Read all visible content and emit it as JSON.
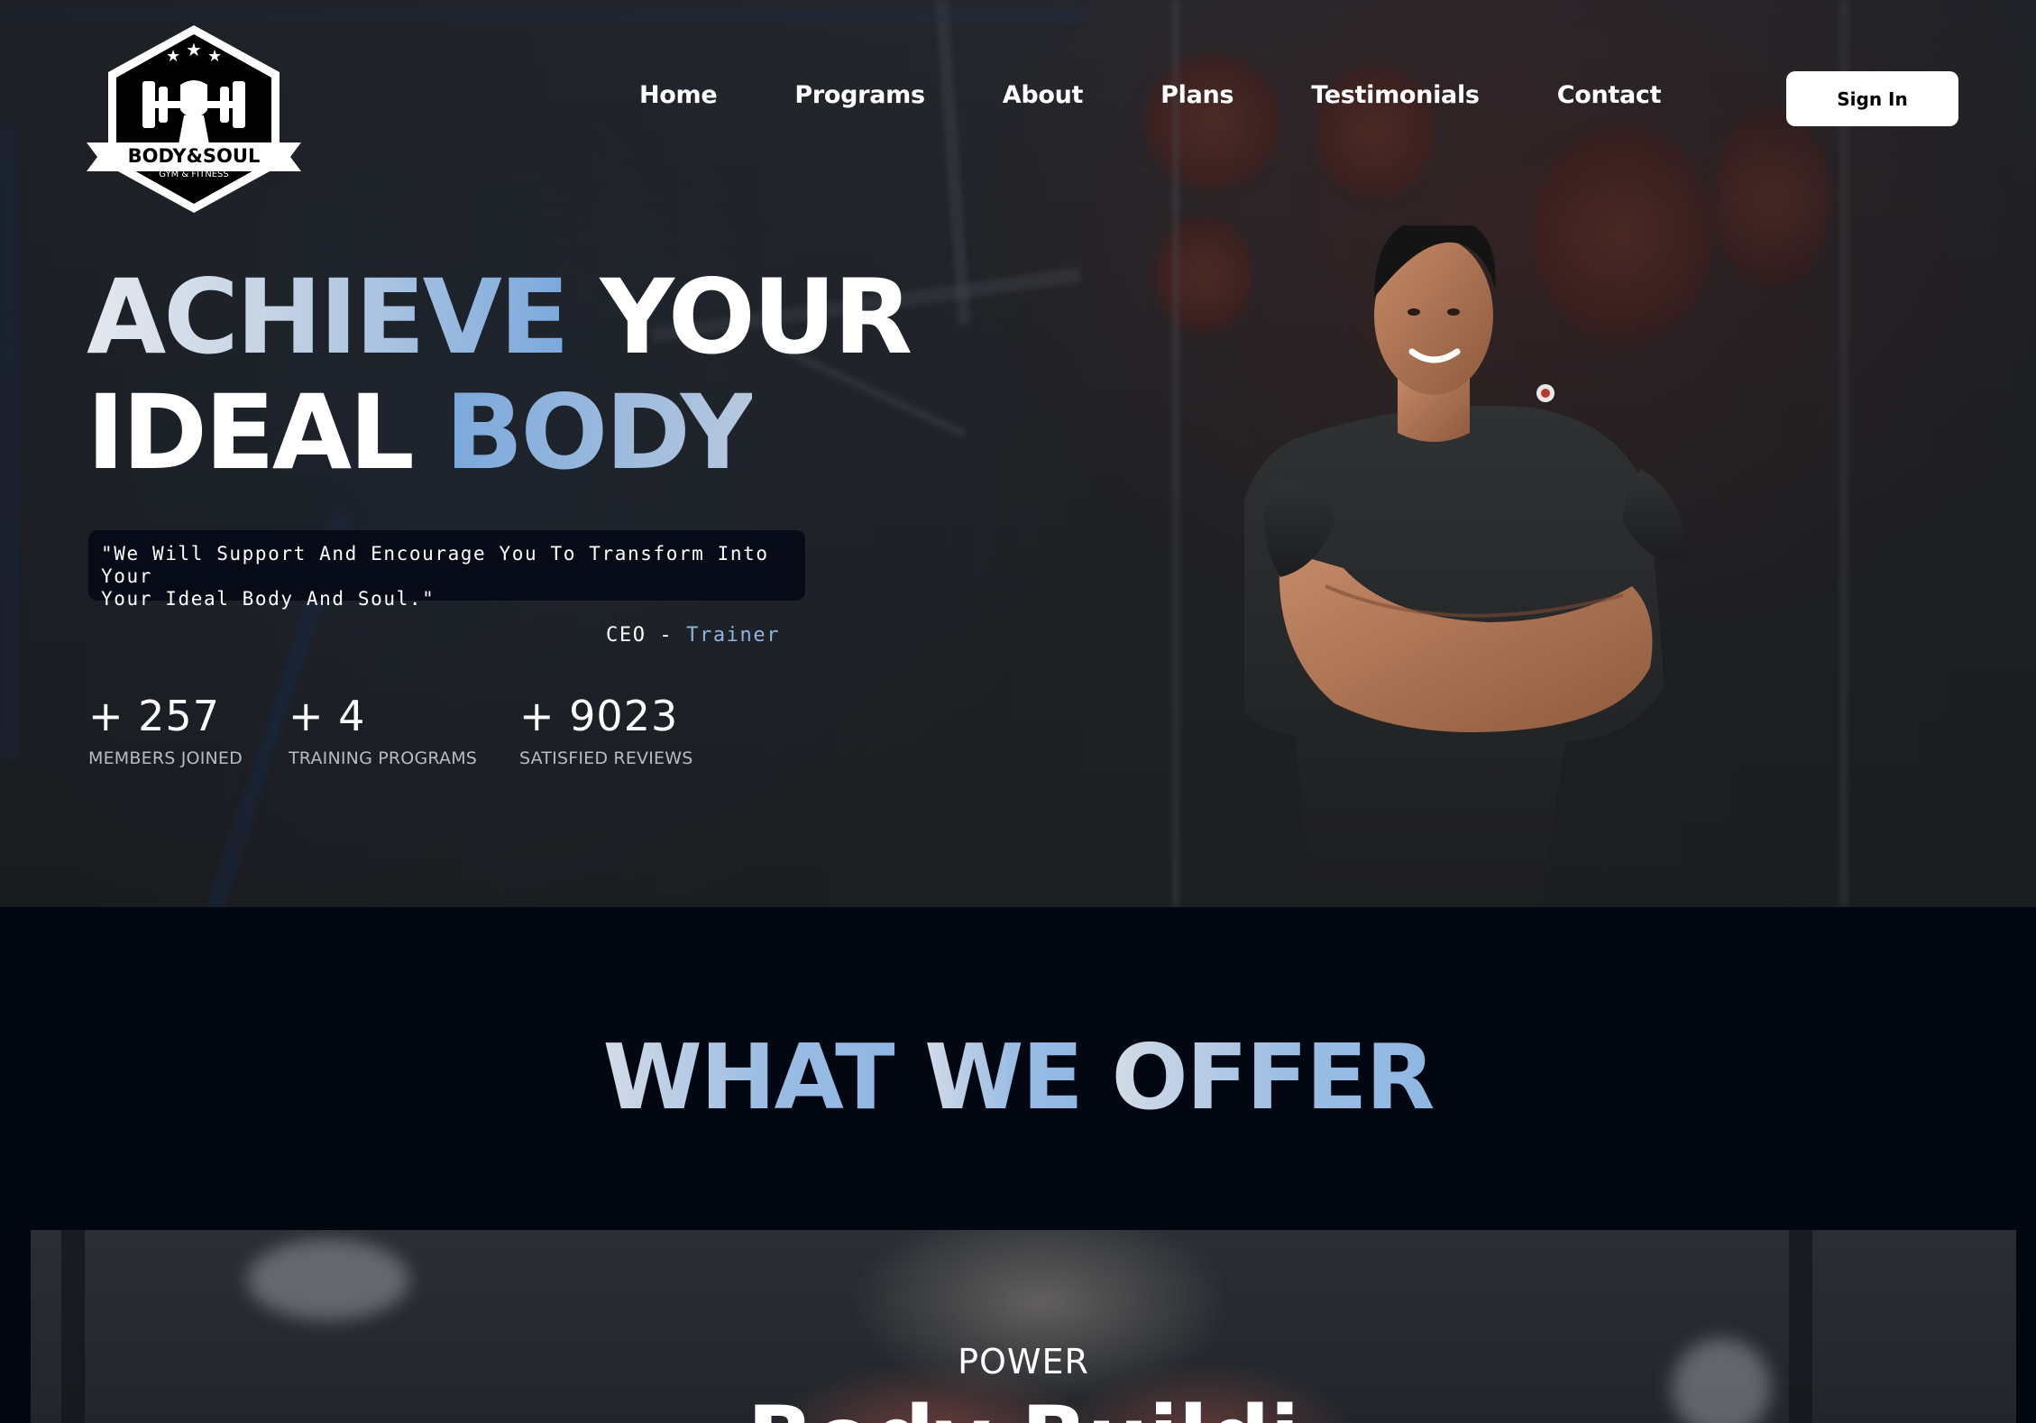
{
  "brand": {
    "name": "BODY&SOUL",
    "tagline": "GYM & FITNESS"
  },
  "nav": {
    "items": [
      "Home",
      "Programs",
      "About",
      "Plans",
      "Testimonials",
      "Contact"
    ],
    "signin_label": "Sign In"
  },
  "hero": {
    "headline": {
      "line1_a": "ACHIEVE",
      "line1_b": "YOUR",
      "line2_a": "IDEAL",
      "line2_b": "BODY"
    },
    "quote_line1": "\"We Will Support And Encourage You To Transform Into Your",
    "quote_line2": "Your Ideal Body And Soul.\"",
    "author_title": "CEO",
    "author_sep": "-",
    "author_role": "Trainer",
    "stats": [
      {
        "value": "+ 257",
        "label": "MEMBERS JOINED"
      },
      {
        "value": "+ 4",
        "label": "TRAINING PROGRAMS"
      },
      {
        "value": "+ 9023",
        "label": "SATISFIED REVIEWS"
      }
    ]
  },
  "offer": {
    "title_a": "WHAT",
    "title_b": "WE",
    "title_c": "OFFER",
    "card": {
      "kicker": "POWER",
      "name": "Body Buildi"
    }
  },
  "colors": {
    "accent_blue": "#8fb4e2",
    "section_bg": "#030712",
    "quote_bg": "#070b17"
  },
  "icons": {
    "logo": "dumbbell-fist-badge-icon"
  }
}
